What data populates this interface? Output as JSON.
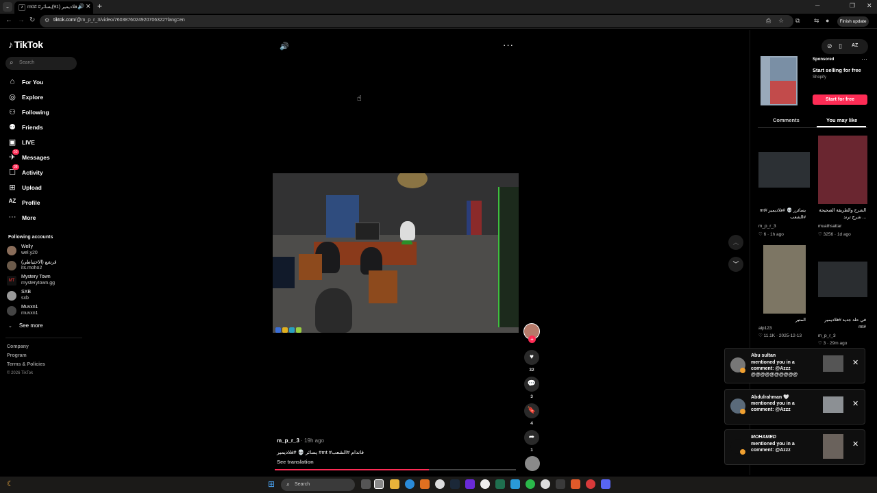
{
  "browser": {
    "tab_title": "m0# #فلاديمير (91)يسائر",
    "url_domain": "tiktok.com",
    "url_path": "/@m_p_r_3/video/7603876024920706322?lang=en",
    "finish_update": "Finish update"
  },
  "sidebar": {
    "logo": "TikTok",
    "search_placeholder": "Search",
    "items": [
      {
        "label": "For You",
        "icon": "home-icon"
      },
      {
        "label": "Explore",
        "icon": "compass-icon"
      },
      {
        "label": "Following",
        "icon": "following-icon"
      },
      {
        "label": "Friends",
        "icon": "friends-icon"
      },
      {
        "label": "LIVE",
        "icon": "live-icon"
      },
      {
        "label": "Messages",
        "icon": "messages-icon",
        "badge": "53"
      },
      {
        "label": "Activity",
        "icon": "activity-icon",
        "badge": "38"
      },
      {
        "label": "Upload",
        "icon": "upload-icon"
      },
      {
        "label": "Profile",
        "icon": "profile-icon"
      },
      {
        "label": "More",
        "icon": "more-icon"
      }
    ],
    "following_title": "Following accounts",
    "accounts": [
      {
        "name": "Welly",
        "handle": "wel.y20"
      },
      {
        "name": "قرشع (الاحتياطي)",
        "handle": "its.moho2"
      },
      {
        "name": "Mystery Town",
        "handle": "mysterytown.gg"
      },
      {
        "name": "SXB",
        "handle": "sxb"
      },
      {
        "name": "Muvxn1",
        "handle": "muvxn1"
      }
    ],
    "see_more": "See more",
    "footer": [
      "Company",
      "Program",
      "Terms & Policies"
    ],
    "copyright": "© 2026 TikTok"
  },
  "video": {
    "author": "m_p_r_3",
    "posted": "· 19h ago",
    "caption": "يسائر 💀 #فلاديمير #mt #فاندام #الشعب",
    "see_translation": "See translation",
    "progress": 0.64
  },
  "actions": {
    "likes": "32",
    "comments": "3",
    "saves": "4",
    "shares": "1"
  },
  "right": {
    "sponsored": "Sponsored",
    "ad_title": "Start selling for free",
    "ad_brand": "Shopify",
    "ad_cta": "Start for free",
    "tab_comments": "Comments",
    "tab_you_may_like": "You may like",
    "recs": [
      {
        "caption": "يسائرر 💀 #فلاديمير #mt #الشعب",
        "user": "m_p_r_3",
        "meta": "♡ 6 · 1h ago"
      },
      {
        "caption": "الشرح والطريقة الصحيحة ... شرح ترند",
        "user": "muathsattar",
        "meta": "♡ 3256 · 1d ago"
      },
      {
        "caption": "المتير",
        "user": "alp123",
        "meta": "♡ 11.1K · 2025-12-13"
      },
      {
        "caption": "في حلد جديد #فلاديمير #mt",
        "user": "m_p_r_3",
        "meta": "♡ 3 · 29m ago"
      }
    ]
  },
  "notifications": [
    {
      "name": "Abu sultan",
      "l1": "mentioned you in a",
      "l2": "comment: @Azzz",
      "l3": "@@@@@@@@@@"
    },
    {
      "name": "Abdulrahman 🤍",
      "l1": "mentioned you in a",
      "l2": "comment: @Azzz",
      "l3": ""
    },
    {
      "name": "MOHAMED",
      "l1": "mentioned you in a",
      "l2": "comment: @Azzz",
      "l3": ""
    }
  ],
  "taskbar": {
    "search_placeholder": "Search"
  },
  "colors": {
    "accent": "#fe2c55",
    "background": "#000000",
    "panel": "#1e1e1e"
  }
}
